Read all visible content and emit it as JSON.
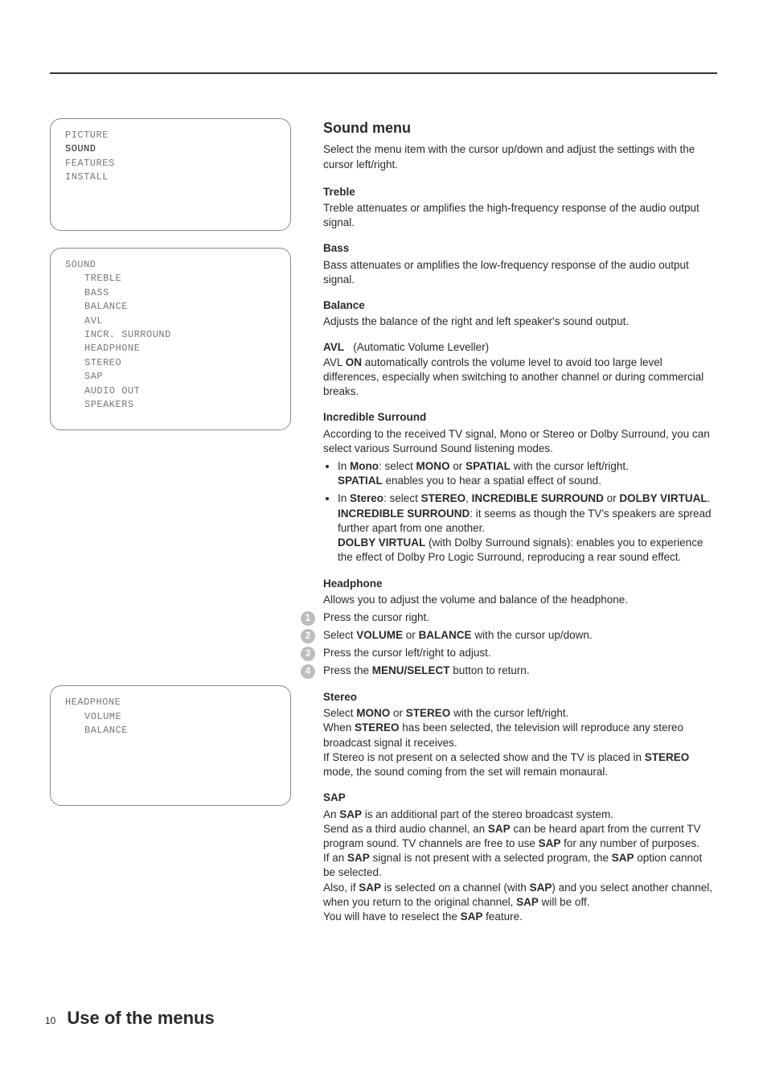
{
  "menus": {
    "mainMenu": {
      "items": [
        "PICTURE",
        "SOUND",
        "FEATURES",
        "INSTALL"
      ],
      "highlightIndex": 1
    },
    "soundMenu": {
      "title": "SOUND",
      "items": [
        "TREBLE",
        "BASS",
        "BALANCE",
        "AVL",
        "INCR. SURROUND",
        "HEADPHONE",
        "STEREO",
        "SAP",
        "AUDIO OUT",
        "SPEAKERS"
      ]
    },
    "headphoneMenu": {
      "title": "HEADPHONE",
      "items": [
        "VOLUME",
        "BALANCE"
      ]
    }
  },
  "content": {
    "title": "Sound menu",
    "intro": "Select the menu item with the cursor up/down and adjust the settings with the cursor left/right.",
    "treble": {
      "head": "Treble",
      "body": "Treble attenuates or amplifies the high-frequency response of the audio output signal."
    },
    "bass": {
      "head": "Bass",
      "body": "Bass attenuates or amplifies the low-frequency response of the audio output signal."
    },
    "balance": {
      "head": "Balance",
      "body": "Adjusts the balance of the right and left speaker's sound output."
    },
    "avl": {
      "head": "AVL",
      "paren": "(Automatic Volume Leveller)",
      "body1a": "AVL ",
      "body1b": "ON",
      "body1c": " automatically controls the volume level to avoid too large level differences, especially when switching to another channel or during commercial breaks."
    },
    "incr": {
      "head": "Incredible Surround",
      "body": "According to the received TV signal, Mono or Stereo or Dolby Surround, you can select various Surround Sound listening modes.",
      "bullets": {
        "mono1a": "In ",
        "mono1b": "Mono",
        "mono1c": ": select ",
        "mono1d": "MONO",
        "mono1e": " or ",
        "mono1f": "SPATIAL",
        "mono1g": " with the cursor left/right.",
        "mono2a": "SPATIAL",
        "mono2b": " enables you to hear a spatial effect of sound.",
        "stereo1a": "In ",
        "stereo1b": "Stereo",
        "stereo1c": ": select ",
        "stereo1d": "STEREO",
        "stereo1e": ", ",
        "stereo1f": "INCREDIBLE SURROUND",
        "stereo1g": " or ",
        "stereo1h": "DOLBY VIRTUAL",
        "stereo1i": ".",
        "stereo2a": "INCREDIBLE SURROUND",
        "stereo2b": ": it seems as though the TV's speakers are spread further apart from one another.",
        "stereo3a": "DOLBY VIRTUAL",
        "stereo3b": " (with Dolby Surround signals): enables you to experience the effect of Dolby Pro Logic Surround, reproducing a rear sound effect."
      }
    },
    "headphone": {
      "head": "Headphone",
      "body": "Allows you to adjust the volume and balance of the headphone.",
      "steps": {
        "s1": "Press the cursor right.",
        "s2a": "Select ",
        "s2b": "VOLUME",
        "s2c": " or ",
        "s2d": "BALANCE",
        "s2e": " with the cursor up/down.",
        "s3": "Press the cursor left/right to adjust.",
        "s4a": "Press the ",
        "s4b": "MENU/SELECT",
        "s4c": " button to return."
      }
    },
    "stereo": {
      "head": "Stereo",
      "l1a": "Select ",
      "l1b": "MONO",
      "l1c": " or ",
      "l1d": "STEREO",
      "l1e": " with the cursor left/right.",
      "l2a": "When ",
      "l2b": "STEREO",
      "l2c": " has been selected, the television will reproduce any stereo broadcast signal it receives.",
      "l3a": "If Stereo is not present on a selected show and the TV is placed in ",
      "l3b": "STEREO",
      "l3c": " mode,  the sound coming from the set will remain monaural."
    },
    "sap": {
      "head": "SAP",
      "l1a": "An ",
      "l1b": "SAP",
      "l1c": " is an additional part of the stereo broadcast system.",
      "l2a": "Send as a third audio channel, an ",
      "l2b": "SAP",
      "l2c": " can be heard apart from the current TV program sound. TV channels are free to use ",
      "l2d": "SAP",
      "l2e": " for any number of purposes.",
      "l3a": "If an ",
      "l3b": "SAP",
      "l3c": " signal is not present with a selected program, the ",
      "l3d": "SAP",
      "l3e": " option cannot be selected.",
      "l4a": "Also, if ",
      "l4b": "SAP",
      "l4c": " is selected on a channel (with ",
      "l4d": "SAP",
      "l4e": ") and you select another channel, when you return to the original channel, ",
      "l4f": "SAP",
      "l4g": " will be off.",
      "l5a": "You will have to reselect the ",
      "l5b": "SAP",
      "l5c": " feature."
    }
  },
  "footer": {
    "page": "10",
    "title": "Use of the menus"
  }
}
